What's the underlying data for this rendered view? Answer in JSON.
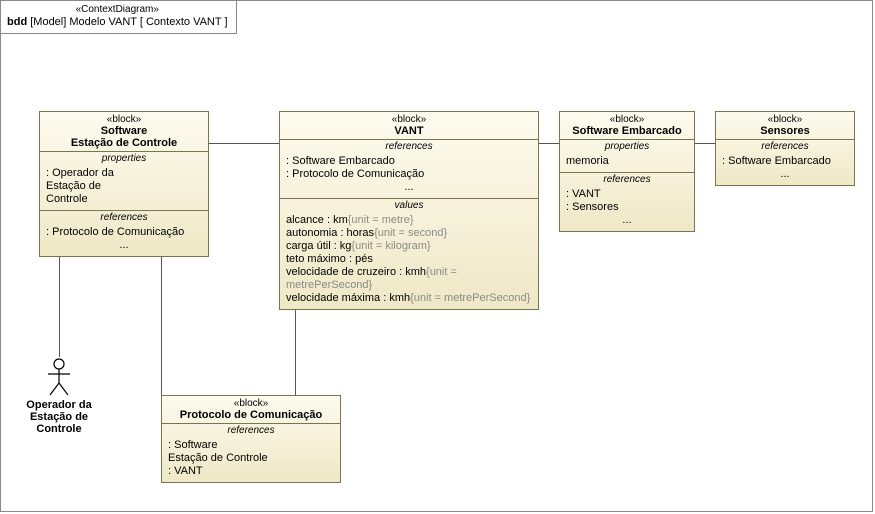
{
  "chart_data": {
    "type": "diagram",
    "diagram_type": "SysML Block Definition Diagram / Context Diagram",
    "frame": {
      "stereotype": "«ContextDiagram»",
      "kind": "bdd",
      "model": "[Model] Modelo VANT",
      "name": "[ Contexto VANT ]"
    },
    "blocks": [
      {
        "id": "software_estacao",
        "stereotype": "«block»",
        "name": "Software\nEstação de Controle",
        "compartments": [
          {
            "label": "properties",
            "entries": [
              ": Operador da\nEstação de\nControle"
            ]
          },
          {
            "label": "references",
            "entries": [
              ": Protocolo de Comunicação"
            ],
            "ellipsis": true
          }
        ]
      },
      {
        "id": "vant",
        "stereotype": "«block»",
        "name": "VANT",
        "compartments": [
          {
            "label": "references",
            "entries": [
              ": Software Embarcado",
              ": Protocolo de Comunicação"
            ],
            "ellipsis": true
          },
          {
            "label": "values",
            "entries": [
              {
                "text": "alcance : km",
                "unit": "{unit = metre}"
              },
              {
                "text": "autonomia : horas",
                "unit": "{unit = second}"
              },
              {
                "text": "carga útil : kg",
                "unit": "{unit = kilogram}"
              },
              {
                "text": "teto máximo : pés",
                "unit": ""
              },
              {
                "text": "velocidade de cruzeiro : kmh",
                "unit": "{unit = metrePerSecond}"
              },
              {
                "text": "velocidade máxima : kmh",
                "unit": "{unit = metrePerSecond}"
              }
            ]
          }
        ]
      },
      {
        "id": "software_embarcado",
        "stereotype": "«block»",
        "name": "Software Embarcado",
        "compartments": [
          {
            "label": "properties",
            "entries": [
              "memoria"
            ]
          },
          {
            "label": "references",
            "entries": [
              ": VANT",
              ": Sensores"
            ],
            "ellipsis": true
          }
        ]
      },
      {
        "id": "sensores",
        "stereotype": "«block»",
        "name": "Sensores",
        "compartments": [
          {
            "label": "references",
            "entries": [
              ": Software Embarcado"
            ],
            "ellipsis": true
          }
        ]
      },
      {
        "id": "protocolo",
        "stereotype": "«block»",
        "name": "Protocolo de Comunicação",
        "compartments": [
          {
            "label": "references",
            "entries": [
              ": Software\nEstação de Controle",
              ": VANT"
            ]
          }
        ]
      }
    ],
    "actors": [
      {
        "id": "operador",
        "name": "Operador da\nEstação de\nControle"
      }
    ],
    "associations": [
      {
        "from": "operador",
        "to": "software_estacao"
      },
      {
        "from": "software_estacao",
        "to": "protocolo"
      },
      {
        "from": "software_estacao",
        "to": "vant"
      },
      {
        "from": "protocolo",
        "to": "vant"
      },
      {
        "from": "vant",
        "to": "software_embarcado"
      },
      {
        "from": "software_embarcado",
        "to": "sensores"
      }
    ]
  },
  "frame": {
    "stereotype": "«ContextDiagram»",
    "kind_b": "bdd",
    "rest": " [Model] Modelo VANT [ Contexto VANT ]"
  },
  "b_software_estacao": {
    "stereo": "«block»",
    "name1": "Software",
    "name2": "Estação de Controle",
    "props_label": "properties",
    "prop1a": ": Operador da",
    "prop1b": "Estação de",
    "prop1c": "Controle",
    "refs_label": "references",
    "ref1": ": Protocolo de Comunicação",
    "ell": "..."
  },
  "b_vant": {
    "stereo": "«block»",
    "name": "VANT",
    "refs_label": "references",
    "ref1": ": Software Embarcado",
    "ref2": ": Protocolo de Comunicação",
    "ell1": "...",
    "vals_label": "values",
    "v1t": "alcance : km",
    "v1u": "{unit = metre}",
    "v2t": "autonomia : horas",
    "v2u": "{unit = second}",
    "v3t": "carga útil : kg",
    "v3u": "{unit = kilogram}",
    "v4t": "teto máximo : pés",
    "v4u": "",
    "v5t": "velocidade de cruzeiro : kmh",
    "v5u": "{unit = metrePerSecond}",
    "v6t": "velocidade máxima : kmh",
    "v6u": "{unit = metrePerSecond}"
  },
  "b_soft_emb": {
    "stereo": "«block»",
    "name": "Software Embarcado",
    "props_label": "properties",
    "prop1": "memoria",
    "refs_label": "references",
    "ref1": ": VANT",
    "ref2": ": Sensores",
    "ell": "..."
  },
  "b_sensores": {
    "stereo": "«block»",
    "name": "Sensores",
    "refs_label": "references",
    "ref1": ": Software Embarcado",
    "ell": "..."
  },
  "b_protocolo": {
    "stereo": "«block»",
    "name": "Protocolo de Comunicação",
    "refs_label": "references",
    "ref1a": ": Software",
    "ref1b": "Estação de Controle",
    "ref2": ": VANT"
  },
  "actor": {
    "name1": "Operador da",
    "name2": "Estação de",
    "name3": "Controle"
  }
}
